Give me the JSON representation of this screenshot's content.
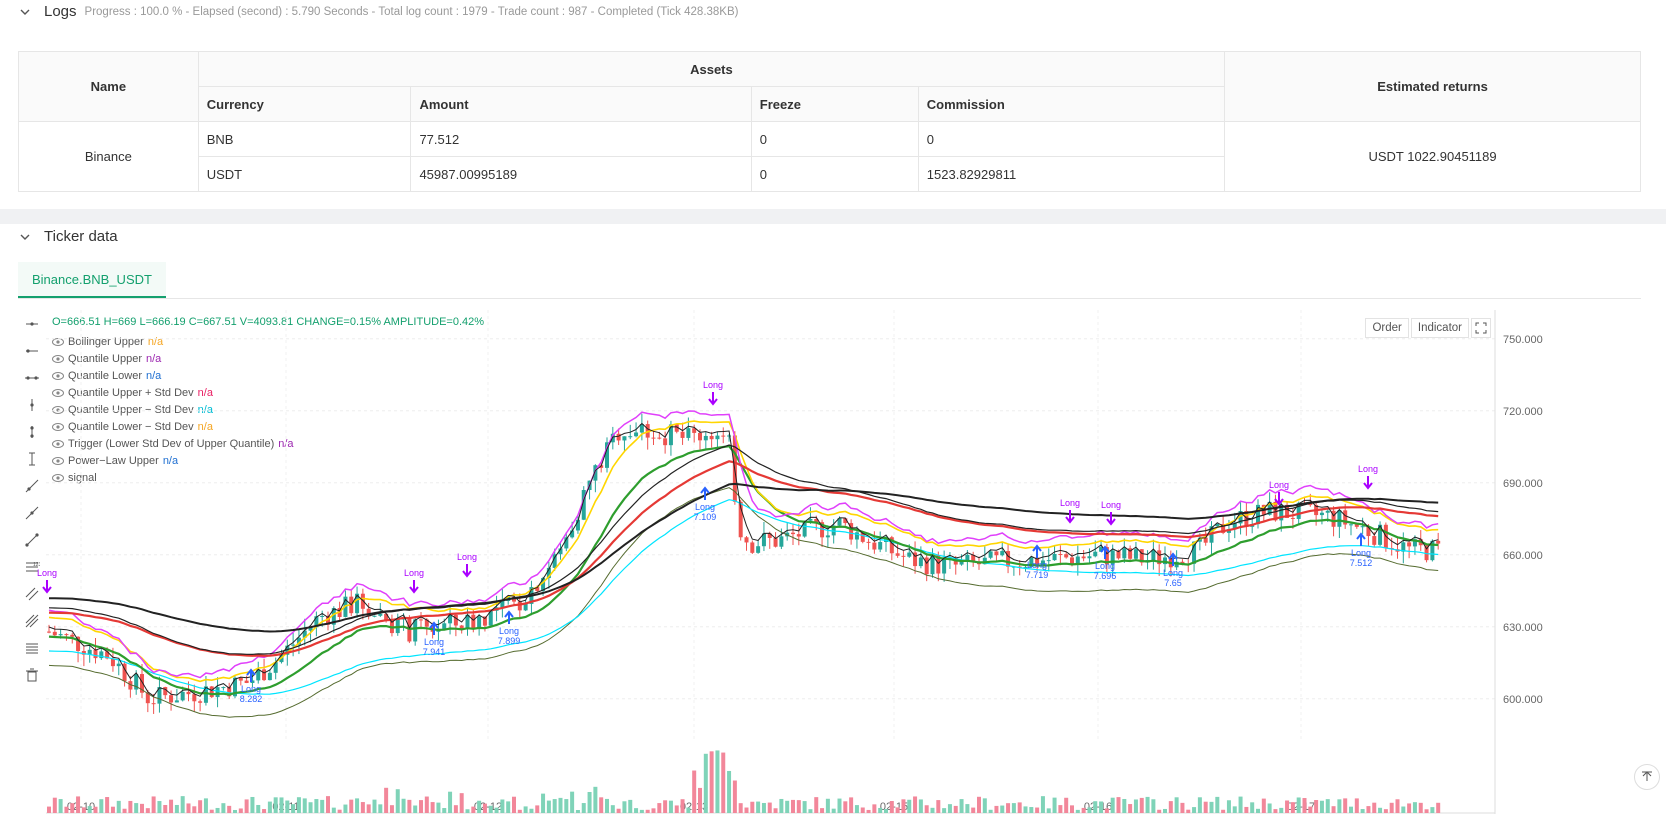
{
  "logs": {
    "title": "Logs",
    "status": "Progress : 100.0 % - Elapsed (second) : 5.790  Seconds - Total log count : 1979 - Trade count : 987 - Completed (Tick 428.38KB)"
  },
  "assets_table": {
    "col_name": "Name",
    "col_assets": "Assets",
    "col_returns": "Estimated returns",
    "sub_currency": "Currency",
    "sub_amount": "Amount",
    "sub_freeze": "Freeze",
    "sub_commission": "Commission",
    "exchange": "Binance",
    "rows": [
      {
        "currency": "BNB",
        "amount": "77.512",
        "freeze": "0",
        "commission": "0"
      },
      {
        "currency": "USDT",
        "amount": "45987.00995189",
        "freeze": "0",
        "commission": "1523.82929811"
      }
    ],
    "estimated_returns": "USDT 1022.90451189"
  },
  "ticker": {
    "title": "Ticker data",
    "tab": "Binance.BNB_USDT",
    "ohlc": "O=666.51  H=669  L=666.19  C=667.51  V=4093.81  CHANGE=0.15%  AMPLITUDE=0.42%",
    "buttons": {
      "order": "Order",
      "indicator": "Indicator"
    },
    "legend": [
      {
        "label": "Bollinger Upper",
        "value": "n/a",
        "color": "#f5a623"
      },
      {
        "label": "Quantile Upper",
        "value": "n/a",
        "color": "#9c27b0"
      },
      {
        "label": "Quantile Lower",
        "value": "n/a",
        "color": "#1f6fd1"
      },
      {
        "label": "Quantile Upper + Std Dev",
        "value": "n/a",
        "color": "#e91e63"
      },
      {
        "label": "Quantile Upper − Std Dev",
        "value": "n/a",
        "color": "#00bcd4"
      },
      {
        "label": "Quantile Lower − Std Dev",
        "value": "n/a",
        "color": "#f5a623"
      },
      {
        "label": "Trigger (Lower Std Dev of Upper Quantile)",
        "value": "n/a",
        "color": "#9c27b0"
      },
      {
        "label": "Power−Law Upper",
        "value": "n/a",
        "color": "#1f6fd1"
      },
      {
        "label": "signal",
        "value": "",
        "color": "#555"
      }
    ]
  },
  "chart_data": {
    "type": "candlestick",
    "x_ticks": [
      "02-10",
      "02-11",
      "02-12",
      "02-13",
      "02-15",
      "02-16",
      "02-17"
    ],
    "y_ticks": [
      "750.000",
      "720.000",
      "690.000",
      "660.000",
      "630.000",
      "600.000"
    ],
    "ylim": [
      582,
      762
    ],
    "long_signals": [
      {
        "label": "Long",
        "value": "8.282"
      },
      {
        "label": "Long",
        "value": "7.941"
      },
      {
        "label": "Long",
        "value": "7.899"
      },
      {
        "label": "Long",
        "value": "7.109"
      },
      {
        "label": "Long",
        "value": "7.719"
      },
      {
        "label": "Long",
        "value": "7.696"
      },
      {
        "label": "Long",
        "value": "7.65"
      },
      {
        "label": "Long",
        "value": "7.512"
      }
    ],
    "top_signal_label": "Long",
    "colors": {
      "up": "#26a69a",
      "down": "#ef5350",
      "vol_up": "#7fd3b8",
      "vol_down": "#f2879a"
    }
  }
}
